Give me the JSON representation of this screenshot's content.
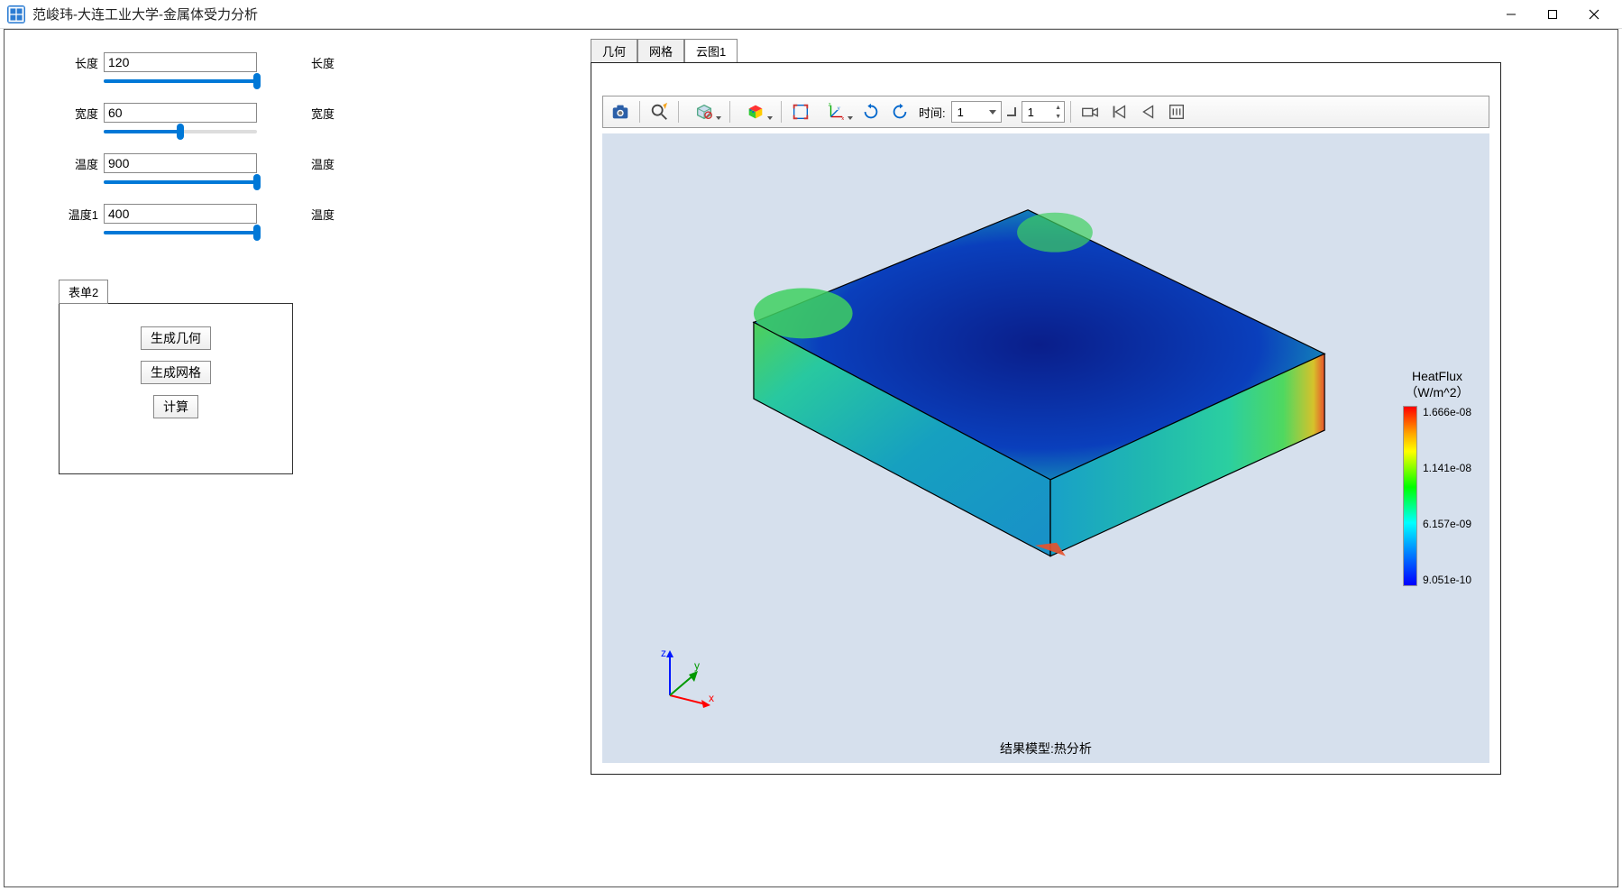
{
  "window": {
    "title": "范峻玮-大连工业大学-金属体受力分析"
  },
  "params": {
    "length_label": "长度",
    "length_value": "120",
    "length_side": "长度",
    "length_pct": 100,
    "width_label": "宽度",
    "width_value": "60",
    "width_side": "宽度",
    "width_pct": 50,
    "temp_label": "温度",
    "temp_value": "900",
    "temp_side": "温度",
    "temp_pct": 100,
    "temp1_label": "温度1",
    "temp1_value": "400",
    "temp1_side": "温度",
    "temp1_pct": 100
  },
  "form": {
    "tab_label": "表单2",
    "btn_geom": "生成几何",
    "btn_mesh": "生成网格",
    "btn_calc": "计算"
  },
  "tabs": {
    "geom": "几何",
    "mesh": "网格",
    "contour": "云图1"
  },
  "toolbar": {
    "time_label": "时间:",
    "time_select": "1",
    "time_spin": "1"
  },
  "viewer": {
    "caption": "结果模型:热分析",
    "triad": {
      "x": "x",
      "y": "y",
      "z": "z"
    }
  },
  "legend": {
    "title1": "HeatFlux",
    "title2": "（W/m^2）",
    "v0": "1.666e-08",
    "v1": "1.141e-08",
    "v2": "6.157e-09",
    "v3": "9.051e-10"
  }
}
